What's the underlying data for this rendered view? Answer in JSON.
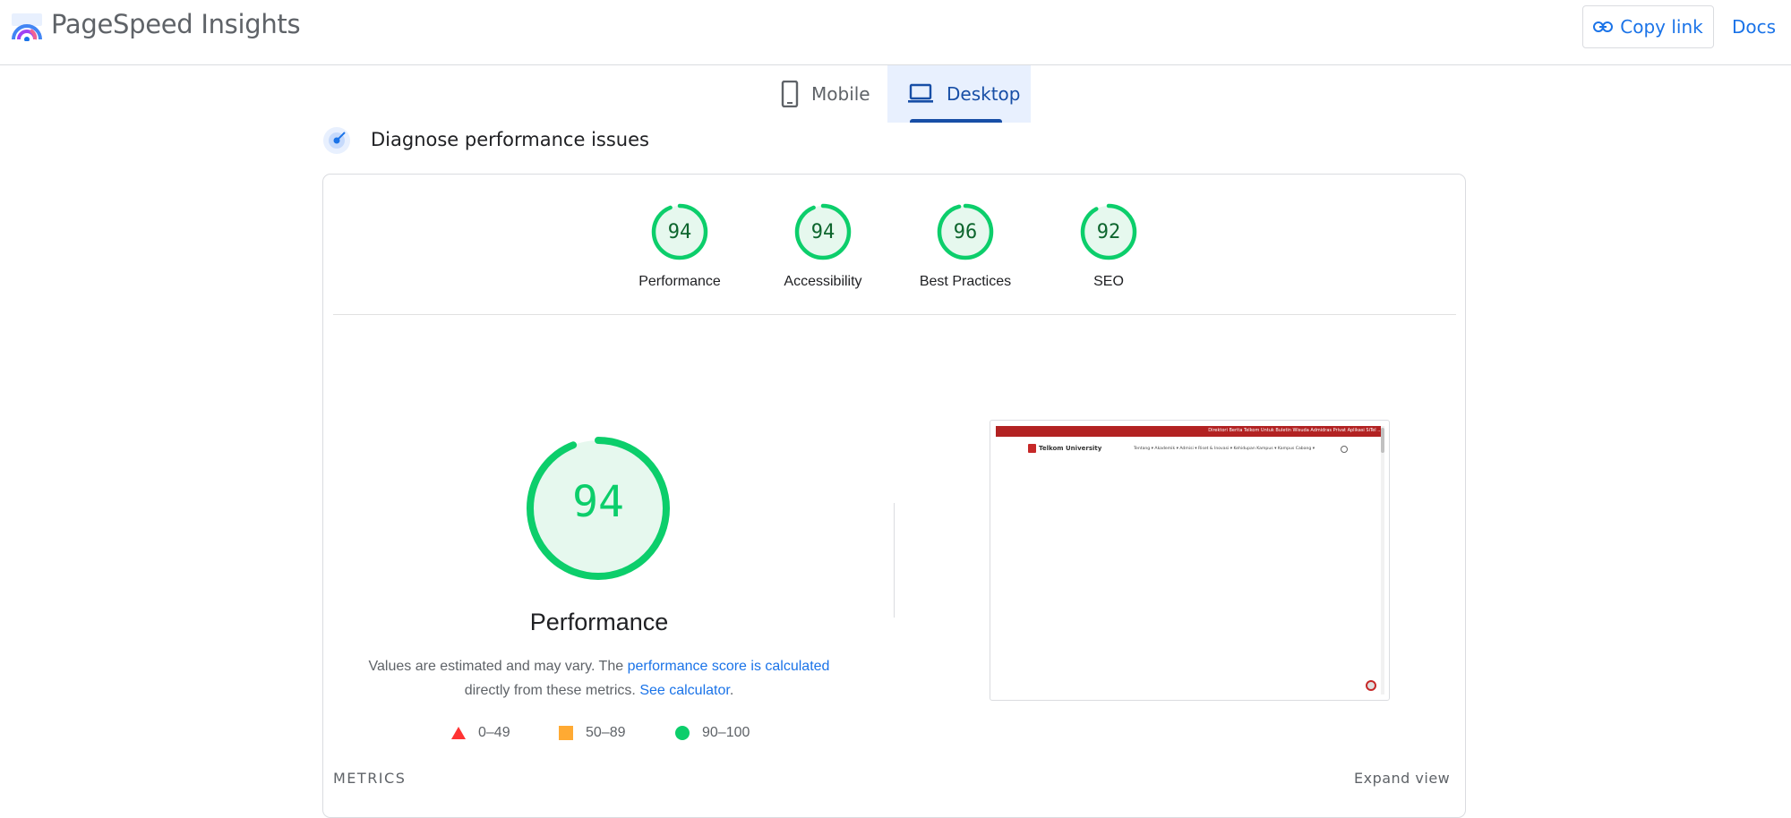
{
  "header": {
    "app_title": "PageSpeed Insights",
    "copy_link_label": "Copy link",
    "docs_label": "Docs"
  },
  "tabs": [
    {
      "label": "Mobile",
      "icon": "smartphone-icon",
      "selected": false
    },
    {
      "label": "Desktop",
      "icon": "laptop-icon",
      "selected": true
    }
  ],
  "diagnose": {
    "title": "Diagnose performance issues"
  },
  "categories": [
    {
      "label": "Performance",
      "score": "94"
    },
    {
      "label": "Accessibility",
      "score": "94"
    },
    {
      "label": "Best Practices",
      "score": "96"
    },
    {
      "label": "SEO",
      "score": "92"
    }
  ],
  "performance": {
    "score": "94",
    "title": "Performance",
    "desc_text_1": "Values are estimated and may vary. The ",
    "desc_link_1": "performance score is calculated",
    "desc_text_2": "directly from these metrics. ",
    "desc_link_2": "See calculator",
    "desc_text_3": "."
  },
  "legend": [
    {
      "range": "0–49",
      "shape": "triangle",
      "color": "#ff3333"
    },
    {
      "range": "50–89",
      "shape": "square",
      "color": "#ffaa33"
    },
    {
      "range": "90–100",
      "shape": "circle",
      "color": "#0cce6b"
    }
  ],
  "preview": {
    "top_links": "Direktori   Berita Telkom   Untuk   Buletin   Wisuda   Admidras   Privat   Aplikasi SiTel ...",
    "logo_text": "Telkom University",
    "nav": "Tentang ▾    Akademik ▾    Admisi ▾    Riset & Inovasi ▾    Kehidupan Kampus ▾    Kampus Cabang ▾"
  },
  "metrics": {
    "label": "METRICS",
    "expand_label": "Expand view"
  },
  "colors": {
    "pass_green": "#0cce6b",
    "pass_text": "#0d652d",
    "accent_blue": "#1a73e8",
    "tab_selected_bg": "#e8f0fe"
  }
}
